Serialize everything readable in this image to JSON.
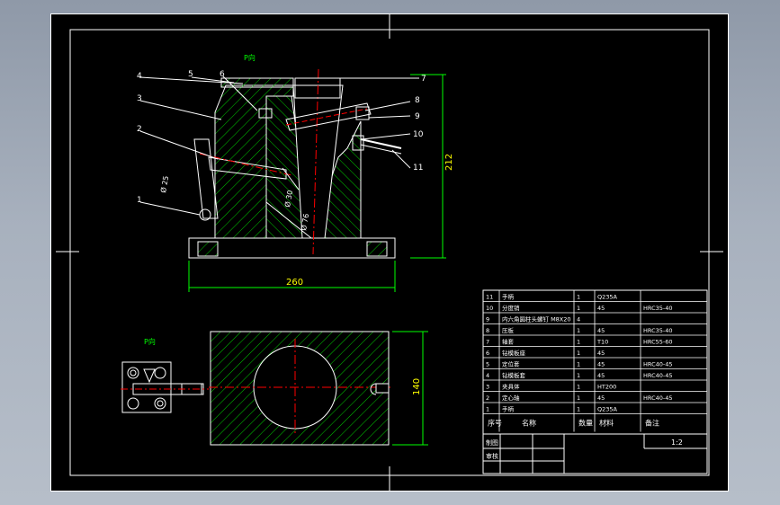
{
  "drawing": {
    "front_view": {
      "view_label": "P向",
      "dimensions": {
        "width": "260",
        "height": "212",
        "bore_top": "Ø 30",
        "bore_bottom": "Ø 76",
        "pin_hole": "Ø 25"
      },
      "part_callouts": [
        "1",
        "2",
        "3",
        "4",
        "5",
        "6",
        "7",
        "8",
        "9",
        "10",
        "11"
      ]
    },
    "top_view": {
      "view_label": "P向",
      "dimension_height": "140"
    },
    "bom": {
      "rows": [
        {
          "no": "11",
          "name": "手柄",
          "qty": "1",
          "material": "Q235A",
          "note": ""
        },
        {
          "no": "10",
          "name": "分度销",
          "qty": "1",
          "material": "45",
          "note": "HRC35-40"
        },
        {
          "no": "9",
          "name": "内六角圆柱头螺钉 M8X20",
          "qty": "4",
          "material": "",
          "note": ""
        },
        {
          "no": "8",
          "name": "压板",
          "qty": "1",
          "material": "45",
          "note": "HRC35-40"
        },
        {
          "no": "7",
          "name": "轴套",
          "qty": "1",
          "material": "T10",
          "note": "HRC55-60"
        },
        {
          "no": "6",
          "name": "钻模板座",
          "qty": "1",
          "material": "45",
          "note": ""
        },
        {
          "no": "5",
          "name": "定位套",
          "qty": "1",
          "material": "45",
          "note": "HRC40-45"
        },
        {
          "no": "4",
          "name": "钻模板套",
          "qty": "1",
          "material": "45",
          "note": "HRC40-45"
        },
        {
          "no": "3",
          "name": "夹具体",
          "qty": "1",
          "material": "HT200",
          "note": ""
        },
        {
          "no": "2",
          "name": "定心轴",
          "qty": "1",
          "material": "45",
          "note": "HRC40-45"
        },
        {
          "no": "1",
          "name": "手柄",
          "qty": "1",
          "material": "Q235A",
          "note": ""
        }
      ],
      "header": {
        "no": "序号",
        "name": "名称",
        "qty": "数量",
        "material": "材料",
        "note": "备注"
      },
      "title_block": {
        "drawn": "制图",
        "checked": "审核",
        "scale": "1:2"
      }
    },
    "colors": {
      "outline": "#ffffff",
      "hatch": "#00ff00",
      "center": "#ff0000",
      "text": "#ffff00",
      "body": "#00c800"
    }
  }
}
